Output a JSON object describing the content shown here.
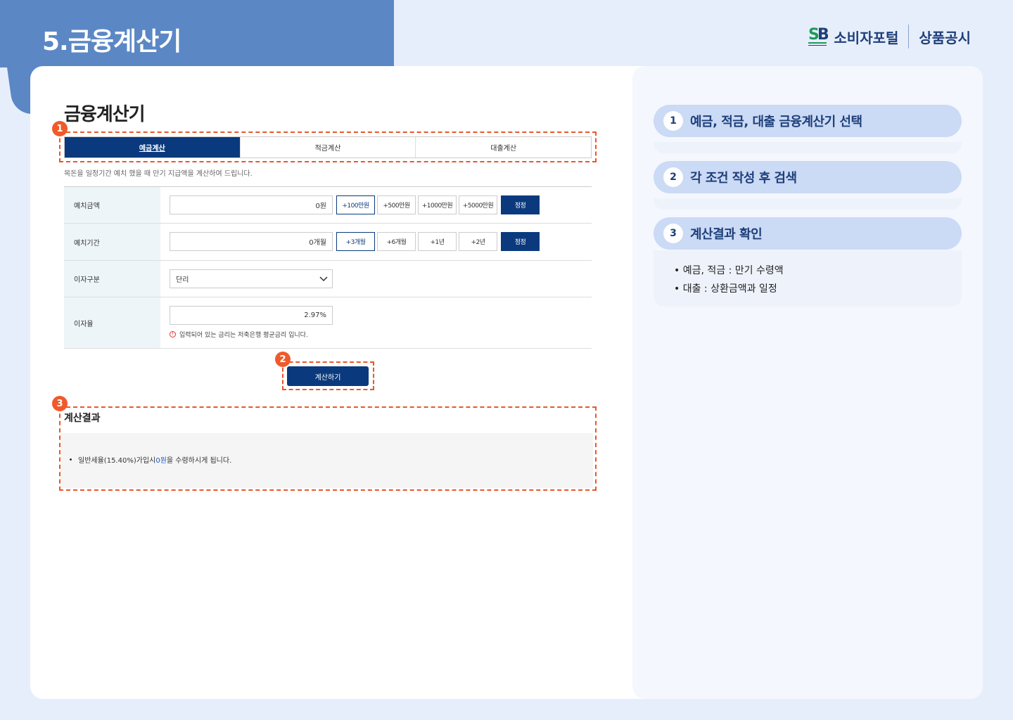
{
  "page": {
    "title": "5.금융계산기"
  },
  "brand": {
    "name": "소비자포털",
    "sub": "상품공시"
  },
  "calculator": {
    "title": "금융계산기",
    "tabs": [
      {
        "label": "예금계산",
        "active": true
      },
      {
        "label": "적금계산",
        "active": false
      },
      {
        "label": "대출계산",
        "active": false
      }
    ],
    "description": "목돈을 일정기간 예치 했을 때 만기 지급액을 계산하여 드립니다.",
    "rows": {
      "amount": {
        "label": "예치금액",
        "value": "0원",
        "chips": [
          "+100만원",
          "+500만원",
          "+1000만원",
          "+5000만원"
        ],
        "reset": "정정"
      },
      "period": {
        "label": "예치기간",
        "value": "0개월",
        "chips": [
          "+3개월",
          "+6개월",
          "+1년",
          "+2년"
        ],
        "reset": "정정"
      },
      "interest_type": {
        "label": "이자구분",
        "value": "단리"
      },
      "rate": {
        "label": "이자율",
        "value": "2.97%",
        "note": "입력되어 있는 금리는 저축은행 평균금리 입니다."
      }
    },
    "calculate_button": "계산하기",
    "result": {
      "title": "계산결과",
      "text_before": "일반세율(15.40%)가입시 ",
      "amount": "0원",
      "text_after": "을 수령하시게 됩니다."
    }
  },
  "markers": [
    "1",
    "2",
    "3"
  ],
  "guide": {
    "steps": [
      {
        "num": "1",
        "label": "예금, 적금, 대출 금융계산기 선택"
      },
      {
        "num": "2",
        "label": "각 조건 작성 후 검색"
      },
      {
        "num": "3",
        "label": "계산결과 확인"
      }
    ],
    "notes": [
      "• 예금, 적금 : 만기 수령액",
      "• 대출 : 상환금액과 일정"
    ]
  },
  "colors": {
    "primary": "#0a3a7d",
    "accent": "#f05a2a",
    "header": "#5b87c5",
    "step_bg": "#cbdaf5"
  }
}
